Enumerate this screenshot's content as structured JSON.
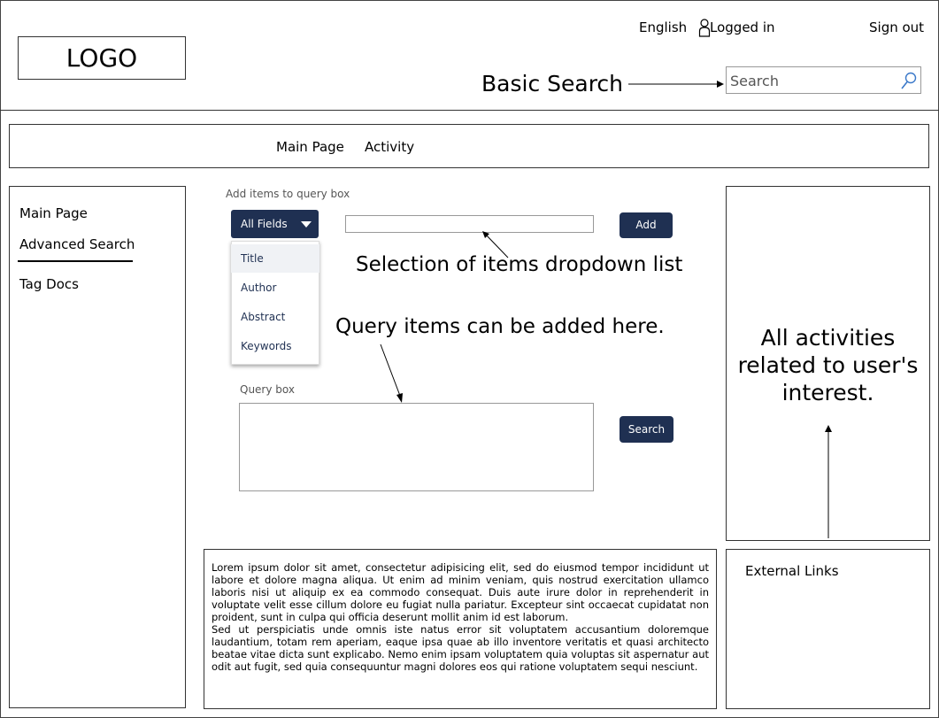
{
  "header": {
    "logo": "LOGO",
    "language": "English",
    "logged_in": "Logged in",
    "sign_out": "Sign out",
    "basic_search_annotation": "Basic Search",
    "search_placeholder": "Search"
  },
  "nav": {
    "items": [
      {
        "label": "Main Page"
      },
      {
        "label": "Activity"
      }
    ]
  },
  "sidebar": {
    "items": [
      {
        "label": "Main Page"
      },
      {
        "label": "Advanced Search",
        "active": true
      },
      {
        "label": "Tag Docs"
      }
    ]
  },
  "query_builder": {
    "add_items_label": "Add items to query box",
    "dropdown_selected": "All Fields",
    "dropdown_options": [
      "Title",
      "Author",
      "Abstract",
      "Keywords"
    ],
    "add_button": "Add",
    "query_box_label": "Query box",
    "search_button": "Search"
  },
  "annotations": {
    "selection": "Selection of items dropdown list",
    "query_here": "Query items can be added here."
  },
  "content": {
    "paragraph1": "Lorem ipsum dolor sit amet, consectetur adipisicing elit, sed do eiusmod tempor incididunt ut labore et dolore magna aliqua. Ut enim ad minim veniam, quis nostrud exercitation ullamco laboris nisi ut aliquip ex ea commodo consequat. Duis aute irure dolor in reprehenderit in voluptate velit esse cillum dolore eu fugiat nulla pariatur. Excepteur sint occaecat cupidatat non proident, sunt in culpa qui officia deserunt mollit anim id est laborum.",
    "paragraph2": "Sed ut perspiciatis unde omnis iste natus error sit voluptatem accusantium doloremque laudantium, totam rem aperiam, eaque ipsa quae ab illo inventore veritatis et quasi architecto beatae vitae dicta sunt explicabo. Nemo enim ipsam voluptatem quia voluptas sit aspernatur aut odit aut fugit, sed quia consequuntur magni dolores eos qui ratione voluptatem sequi nesciunt."
  },
  "right_panel": {
    "activities_text": "All activities related to user's interest.",
    "external_links": "External Links"
  },
  "icons": {
    "user": "user-icon",
    "search": "search-icon",
    "caret": "chevron-down-icon"
  },
  "colors": {
    "button_navy": "#1f3052",
    "text_grey": "#555555"
  }
}
